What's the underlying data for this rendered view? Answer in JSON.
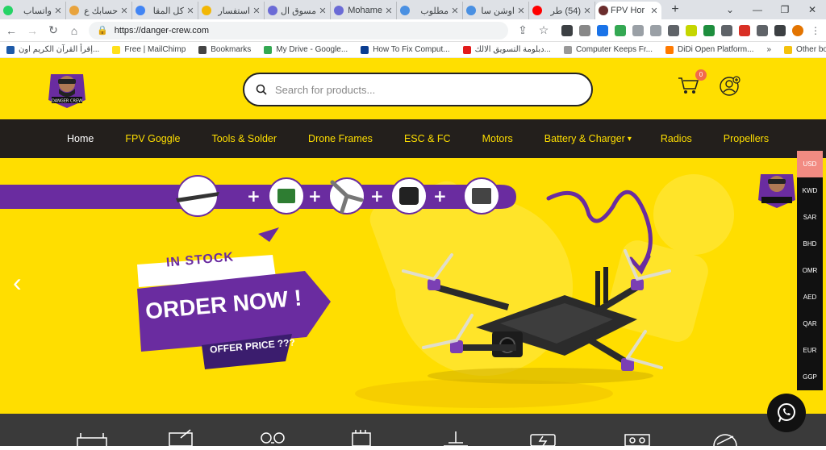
{
  "browser": {
    "tabs": [
      {
        "title": "واتساب",
        "color": "#25d366"
      },
      {
        "title": "حسابك ع",
        "color": "#e8a33d"
      },
      {
        "title": "كل المقا",
        "color": "#4285f4"
      },
      {
        "title": "استفسار",
        "color": "#f2b705"
      },
      {
        "title": "مسوق ال",
        "color": "#6b6bd6"
      },
      {
        "title": "Mohame",
        "color": "#6b6bd6"
      },
      {
        "title": "مطلوب",
        "color": "#4a90e2"
      },
      {
        "title": "اوشن سا",
        "color": "#4a90e2"
      },
      {
        "title": "(54) طر",
        "color": "#ff0000"
      },
      {
        "title": "FPV Hor",
        "color": "#6b2d2d"
      }
    ],
    "new_tab": "+",
    "window_controls": [
      "⌄",
      "—",
      "❐",
      "✕"
    ],
    "url": "https://danger-crew.com",
    "bookmarks": [
      {
        "label": "إقرأ القرآن الكريم اون...",
        "color": "#1e5aa8"
      },
      {
        "label": "Free | MailChimp",
        "color": "#ffe01b"
      },
      {
        "label": "Bookmarks",
        "color": "#444"
      },
      {
        "label": "My Drive - Google...",
        "color": "#34a853"
      },
      {
        "label": "How To Fix Comput...",
        "color": "#0b3d91"
      },
      {
        "label": "دبلومة التسويق الالك...",
        "color": "#e21b1b"
      },
      {
        "label": "Computer Keeps Fr...",
        "color": "#999"
      },
      {
        "label": "DiDi Open Platform...",
        "color": "#ff7a00"
      }
    ],
    "other_bookmarks": "Other bookmarks"
  },
  "site": {
    "search_placeholder": "Search for products...",
    "cart_count": "0",
    "nav": [
      {
        "label": "Home"
      },
      {
        "label": "FPV Goggle"
      },
      {
        "label": "Tools & Solder"
      },
      {
        "label": "Drone Frames"
      },
      {
        "label": "ESC & FC"
      },
      {
        "label": "Motors"
      },
      {
        "label": "Battery & Charger"
      },
      {
        "label": "Radios"
      },
      {
        "label": "Propellers"
      }
    ],
    "hero": {
      "badge": "IN STOCK",
      "headline": "ORDER NOW !",
      "sub": "OFFER PRICE ???",
      "prev_arrow": "‹"
    },
    "currencies": [
      "USD",
      "KWD",
      "SAR",
      "BHD",
      "OMR",
      "AED",
      "QAR",
      "EUR",
      "GGP"
    ],
    "selected_currency": "USD",
    "colors": {
      "brand_yellow": "#ffdf00",
      "nav_bg": "#231f1c",
      "accent_purple": "#6a2ca0",
      "currency_selected": "#f28b82"
    }
  }
}
